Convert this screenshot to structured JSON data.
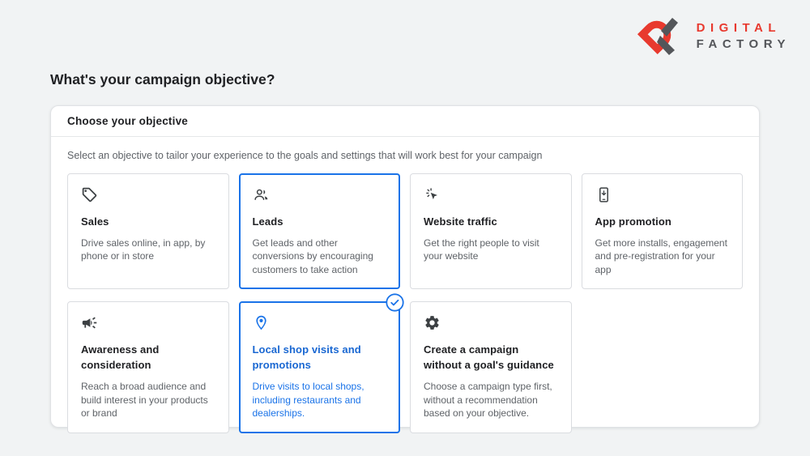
{
  "logo": {
    "line1": "DIGITAL",
    "line2": "FACTORY"
  },
  "page_title": "What's your campaign objective?",
  "panel": {
    "header": "Choose your objective",
    "subtitle": "Select an objective to tailor your experience to the goals and settings that will work best for your campaign",
    "objectives": [
      {
        "id": "sales",
        "icon": "tag-icon",
        "title": "Sales",
        "description": "Drive sales online, in app, by phone or in store",
        "selected": false
      },
      {
        "id": "leads",
        "icon": "people-icon",
        "title": "Leads",
        "description": "Get leads and other conversions by encouraging customers to take action",
        "selected": true
      },
      {
        "id": "website-traffic",
        "icon": "cursor-click-icon",
        "title": "Website traffic",
        "description": "Get the right people to visit your website",
        "selected": false
      },
      {
        "id": "app-promotion",
        "icon": "phone-download-icon",
        "title": "App promotion",
        "description": "Get more installs, engagement and pre-registration for your app",
        "selected": false
      },
      {
        "id": "awareness",
        "icon": "megaphone-icon",
        "title": "Awareness and consideration",
        "description": "Reach a broad audience and build interest in your products or brand",
        "selected": false
      },
      {
        "id": "local-shop",
        "icon": "location-pin-icon",
        "title": "Local shop visits and promotions",
        "description": "Drive visits to local shops, including restaurants and dealerships.",
        "selected": true,
        "checked": true
      },
      {
        "id": "no-goal",
        "icon": "gear-icon",
        "title": "Create a campaign without a goal's guidance",
        "description": "Choose a campaign type first, without a recommendation based on your objective.",
        "selected": false
      }
    ]
  },
  "icons": {
    "selected_badge": "check-circle-icon",
    "brand_mark": "digital-factory-logo-mark"
  },
  "colors": {
    "accent_blue": "#1a73e8",
    "selected_title_blue": "#1967d2",
    "brand_red": "#e8392e",
    "brand_gray": "#54565a",
    "page_background": "#f1f3f4",
    "text_primary": "#202124",
    "text_secondary": "#5f6368",
    "card_border": "#dadce0"
  }
}
